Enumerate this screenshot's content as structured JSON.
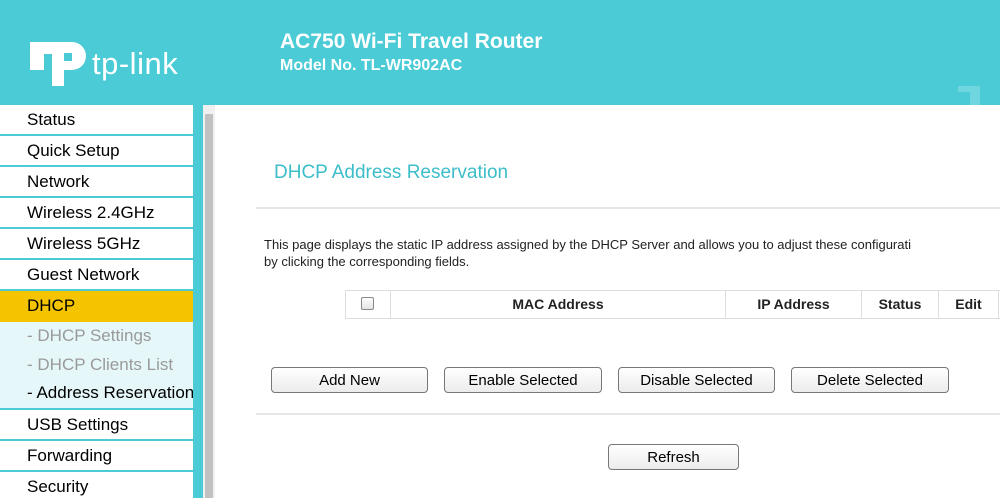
{
  "header": {
    "brand": "tp-link",
    "product_title": "AC750 Wi-Fi Travel Router",
    "model_no": "Model No. TL-WR902AC",
    "background": "#4acbd6"
  },
  "sidebar": {
    "items": [
      {
        "label": "Status"
      },
      {
        "label": "Quick Setup"
      },
      {
        "label": "Network"
      },
      {
        "label": "Wireless 2.4GHz"
      },
      {
        "label": "Wireless 5GHz"
      },
      {
        "label": "Guest Network"
      },
      {
        "label": "DHCP",
        "active": true
      },
      {
        "label": "USB Settings"
      },
      {
        "label": "Forwarding"
      },
      {
        "label": "Security"
      }
    ],
    "dhcp_subitems": [
      {
        "label": "- DHCP Settings"
      },
      {
        "label": "- DHCP Clients List"
      },
      {
        "label": "- Address Reservation",
        "current": true
      }
    ],
    "active_color": "#f5c400"
  },
  "main": {
    "title": "DHCP Address Reservation",
    "description_line1": "This page displays the static IP address assigned by the DHCP Server and allows you to adjust these configurati",
    "description_line2": "by clicking the corresponding fields.",
    "table": {
      "columns": [
        "MAC Address",
        "IP Address",
        "Status",
        "Edit"
      ],
      "rows": []
    },
    "buttons": {
      "add_new": "Add New",
      "enable_selected": "Enable Selected",
      "disable_selected": "Disable Selected",
      "delete_selected": "Delete Selected",
      "refresh": "Refresh"
    }
  }
}
